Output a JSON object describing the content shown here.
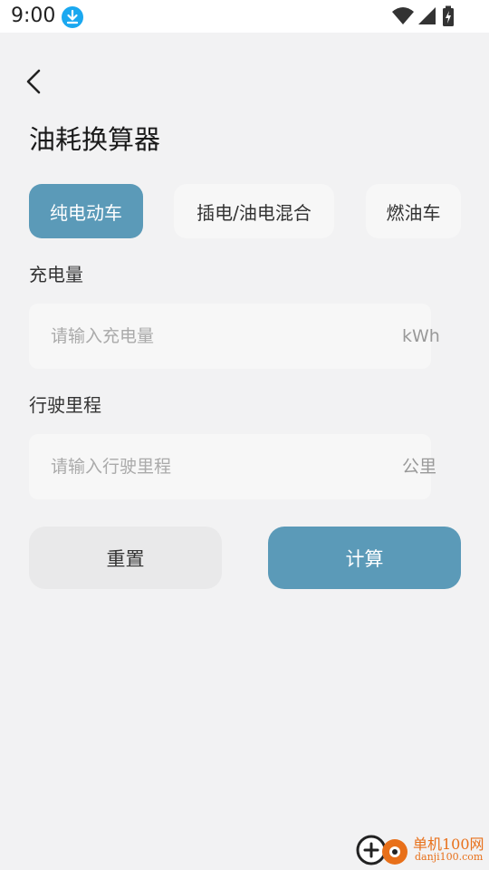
{
  "status_bar": {
    "time": "9:00",
    "icons": [
      "download-icon",
      "wifi-icon",
      "signal-icon",
      "battery-charging-icon"
    ]
  },
  "header": {
    "back_icon": "chevron-left-icon",
    "title": "油耗换算器"
  },
  "tabs": [
    {
      "label": "纯电动车",
      "active": true
    },
    {
      "label": "插电/油电混合",
      "active": false
    },
    {
      "label": "燃油车",
      "active": false
    }
  ],
  "fields": {
    "charge": {
      "label": "充电量",
      "placeholder": "请输入充电量",
      "value": "",
      "unit": "kWh"
    },
    "distance": {
      "label": "行驶里程",
      "placeholder": "请输入行驶里程",
      "value": "",
      "unit": "公里"
    }
  },
  "buttons": {
    "reset": "重置",
    "calculate": "计算"
  },
  "watermark": {
    "line1": "单机100网",
    "line2": "danji100.com"
  },
  "colors": {
    "accent": "#5b9ab8",
    "background": "#f2f2f3",
    "field_bg": "#f7f7f7",
    "watermark": "#e8701a"
  }
}
